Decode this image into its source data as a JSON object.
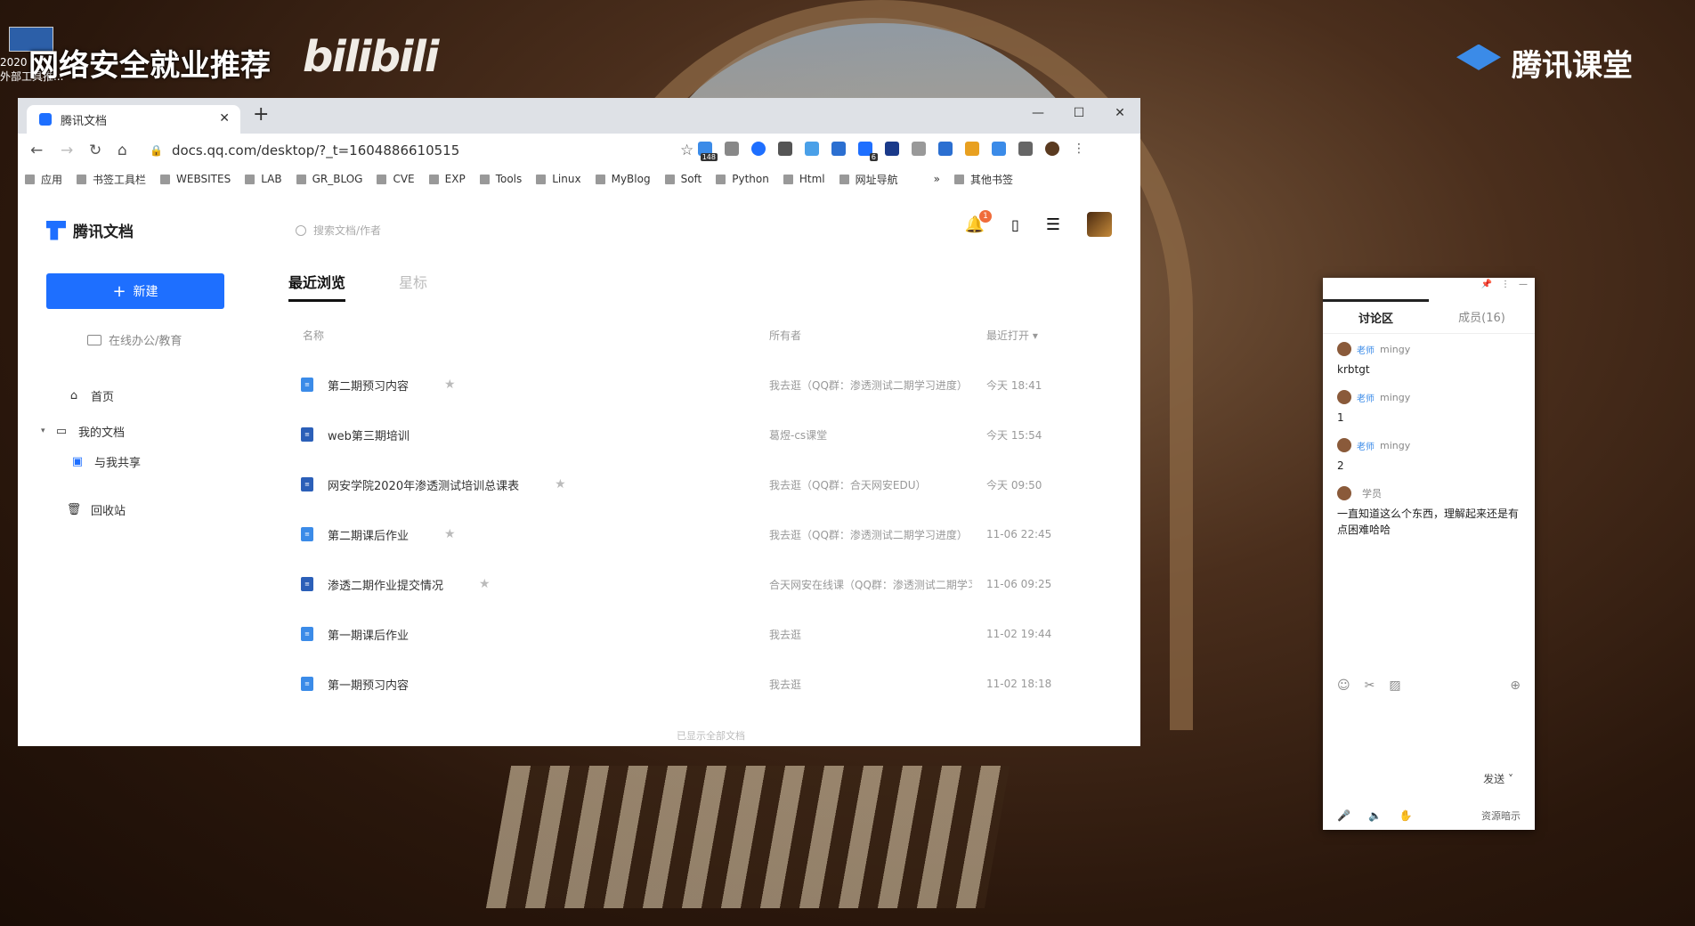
{
  "overlay": {
    "title": "网络安全就业推荐",
    "bilibili": "bilibili",
    "brand": "腾讯课堂",
    "corner_text": "2020\n外部工具推..."
  },
  "browser": {
    "tab_title": "腾讯文档",
    "url": "docs.qq.com/desktop/?_t=1604886610515",
    "bookmarks": [
      "应用",
      "书签工具栏",
      "WEBSITES",
      "LAB",
      "GR_BLOG",
      "CVE",
      "EXP",
      "Tools",
      "Linux",
      "MyBlog",
      "Soft",
      "Python",
      "Html",
      "网址导航",
      "»",
      "其他书签"
    ],
    "ext_badge_1": "148",
    "ext_badge_2": "6"
  },
  "app": {
    "logo": "腾讯文档",
    "search_placeholder": "搜索文档/作者",
    "notif_count": "1",
    "new_button": "新建",
    "online_office": "在线办公/教育",
    "nav": {
      "home": "首页",
      "my_docs": "我的文档",
      "shared": "与我共享",
      "trash": "回收站"
    },
    "tabs": [
      "最近浏览",
      "星标"
    ],
    "columns": {
      "name": "名称",
      "owner": "所有者",
      "opened": "最近打开 ▾"
    },
    "rows": [
      {
        "name": "第二期预习内容",
        "starred": true,
        "owner": "我去逛（QQ群：渗透测试二期学习进度）",
        "time": "今天 18:41"
      },
      {
        "name": "web第三期培训",
        "starred": false,
        "owner": "葛煜-cs课堂",
        "time": "今天 15:54"
      },
      {
        "name": "网安学院2020年渗透测试培训总课表",
        "starred": true,
        "owner": "我去逛（QQ群：合天网安EDU）",
        "time": "今天 09:50"
      },
      {
        "name": "第二期课后作业",
        "starred": true,
        "owner": "我去逛（QQ群：渗透测试二期学习进度）",
        "time": "11-06 22:45"
      },
      {
        "name": "渗透二期作业提交情况",
        "starred": true,
        "owner": "合天网安在线课（QQ群：渗透测试二期学习进度）",
        "time": "11-06 09:25"
      },
      {
        "name": "第一期课后作业",
        "starred": false,
        "owner": "我去逛",
        "time": "11-02 19:44"
      },
      {
        "name": "第一期预习内容",
        "starred": false,
        "owner": "我去逛",
        "time": "11-02 18:18"
      }
    ],
    "footer": "已显示全部文档"
  },
  "discussion": {
    "tab_discuss": "讨论区",
    "tab_members": "成员(16)",
    "messages": [
      {
        "tag": "老师",
        "user": "mingy",
        "text": "krbtgt"
      },
      {
        "tag": "老师",
        "user": "mingy",
        "text": "1"
      },
      {
        "tag": "老师",
        "user": "mingy",
        "text": "2"
      },
      {
        "tag": "",
        "user": "学员",
        "text": "一直知道这么个东西，理解起来还是有点困难哈哈"
      }
    ],
    "send": "发送",
    "resources": "资源暗示"
  },
  "colors": {
    "accent": "#1e6fff",
    "brand_blue": "#3b8be8"
  }
}
